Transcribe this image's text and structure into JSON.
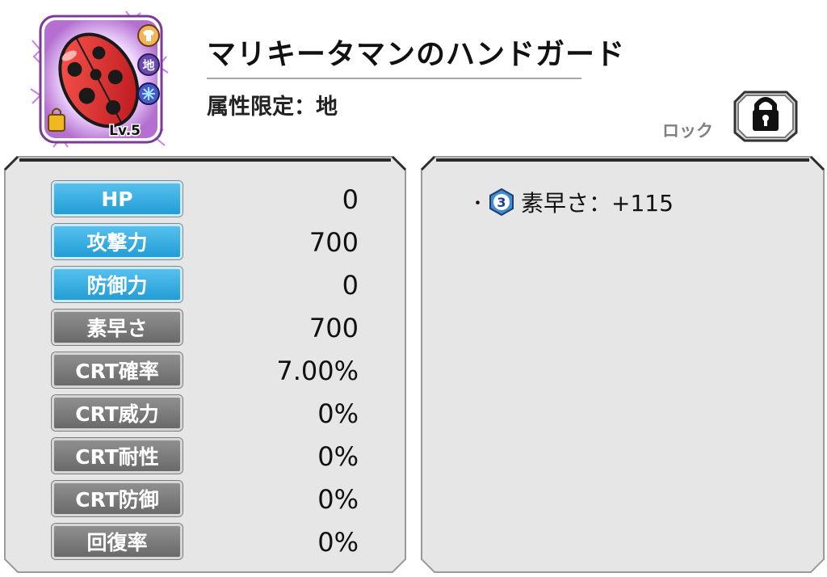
{
  "item": {
    "name": "マリキータマンのハンドガード",
    "attribute_limit": "属性限定：地",
    "level": "Lv.5",
    "icon_name": "ladybug-handguard-icon",
    "side_badges": [
      {
        "name": "armor-type-icon",
        "text": ""
      },
      {
        "name": "earth-element-icon",
        "text": "地"
      },
      {
        "name": "speed-skill-icon",
        "text": ""
      }
    ]
  },
  "lock": {
    "label": "ロック",
    "icon": "padlock-icon"
  },
  "stats": [
    {
      "label": "HP",
      "value": "0",
      "style": "blue"
    },
    {
      "label": "攻撃力",
      "value": "700",
      "style": "blue"
    },
    {
      "label": "防御力",
      "value": "0",
      "style": "blue"
    },
    {
      "label": "素早さ",
      "value": "700",
      "style": "gray"
    },
    {
      "label": "CRT確率",
      "value": "7.00%",
      "style": "gray"
    },
    {
      "label": "CRT威力",
      "value": "0%",
      "style": "gray"
    },
    {
      "label": "CRT耐性",
      "value": "0%",
      "style": "gray"
    },
    {
      "label": "CRT防御",
      "value": "0%",
      "style": "gray"
    },
    {
      "label": "回復率",
      "value": "0%",
      "style": "gray"
    }
  ],
  "options": [
    {
      "bullet": "･",
      "rank": "3",
      "text": "素早さ：+115"
    }
  ],
  "colors": {
    "stat_blue": "#2aa3db",
    "stat_gray": "#7a7a7a",
    "panel_bg": "#e6e6e6",
    "icon_frame": "#b46fd0"
  }
}
